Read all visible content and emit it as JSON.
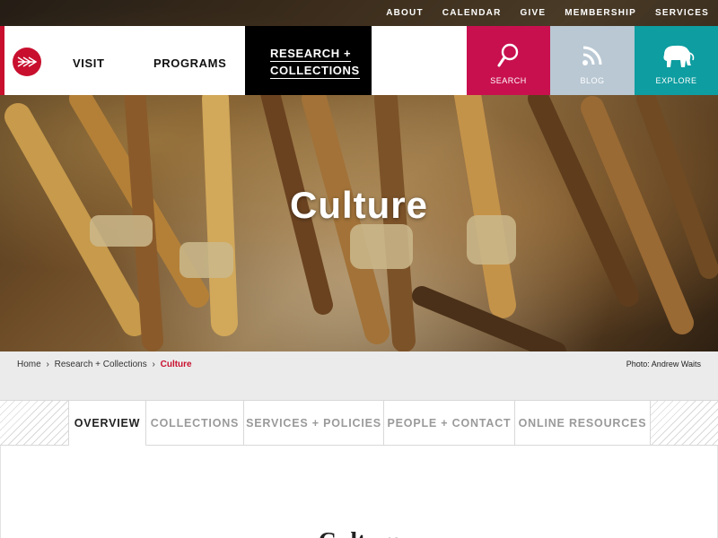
{
  "utility_nav": [
    "ABOUT",
    "CALENDAR",
    "GIVE",
    "MEMBERSHIP",
    "SERVICES"
  ],
  "main_nav": {
    "visit": "VISIT",
    "programs": "PROGRAMS",
    "research_line1": "RESEARCH +",
    "research_line2": "COLLECTIONS"
  },
  "tiles": {
    "search": "SEARCH",
    "blog": "BLOG",
    "explore": "EXPLORE"
  },
  "colors": {
    "brand_red": "#c8102e",
    "search_tile": "#c8104f",
    "blog_tile": "#b9c8d3",
    "explore_tile": "#0e9da0"
  },
  "hero": {
    "title": "Culture"
  },
  "breadcrumb": {
    "home": "Home",
    "sep": "›",
    "section": "Research + Collections",
    "current": "Culture"
  },
  "photo_credit": "Photo: Andrew Waits",
  "tabs": [
    "OVERVIEW",
    "COLLECTIONS",
    "SERVICES + POLICIES",
    "PEOPLE + CONTACT",
    "ONLINE RESOURCES"
  ],
  "content": {
    "heading": "Culture"
  }
}
